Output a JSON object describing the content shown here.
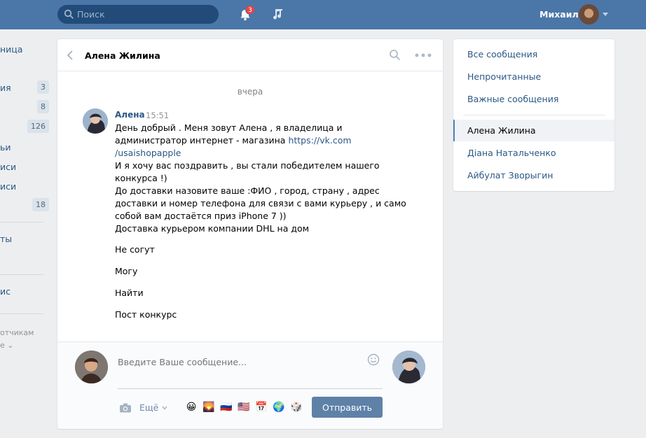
{
  "topbar": {
    "search_placeholder": "Поиск",
    "notifications_count": "3",
    "user_name": "Михаил"
  },
  "leftnav": {
    "items": [
      {
        "label": "ница"
      },
      {
        "label": "ия",
        "count": "3"
      },
      {
        "label": "",
        "count": "8"
      },
      {
        "label": "",
        "count": "126"
      },
      {
        "label": "ьи"
      },
      {
        "label": "иси"
      },
      {
        "label": "иси"
      },
      {
        "label": "",
        "count": "18"
      },
      {
        "label": "ты"
      },
      {
        "label": "ис"
      }
    ],
    "footer_1": "отчикам",
    "footer_2": "е"
  },
  "chat": {
    "title": "Алена Жилина",
    "day_label": "вчера",
    "message": {
      "author": "Алена",
      "time": "15:51",
      "lines": [
        "День добрый . Меня зовут Алена , я владелица и",
        "администратор интернет - магазина ",
        "/usaishopapple",
        "И я хочу вас поздравить , вы стали победителем нашего",
        "конкурса !)",
        "До доставки назовите ваше :ФИО , город, страну , адрес",
        "доставки и номер телефона для связи с вами курьеру , и само",
        "собой вам достаётся приз iPhone 7 ))",
        "Доставка курьером компании DHL на дом"
      ],
      "link_part1": "https://vk.com",
      "followups": [
        "Не согут",
        "Могу",
        "Найти",
        "Пост конкурс"
      ]
    },
    "composer": {
      "placeholder": "Введите Ваше сообщение...",
      "more_label": "Ещё",
      "send_label": "Отправить",
      "emojis": [
        "😀",
        "🌄",
        "🇷🇺",
        "🇺🇸",
        "📅",
        "🌍",
        "🎲"
      ]
    }
  },
  "right_menu": {
    "items": [
      "Все сообщения",
      "Непрочитанные",
      "Важные сообщения"
    ],
    "dialogs": [
      "Алена Жилина",
      "Діана Натальченко",
      "Айбулат Зворыгин"
    ]
  },
  "colors": {
    "header": "#4a76a8",
    "link": "#2a5885",
    "send_button": "#5e81a8"
  }
}
